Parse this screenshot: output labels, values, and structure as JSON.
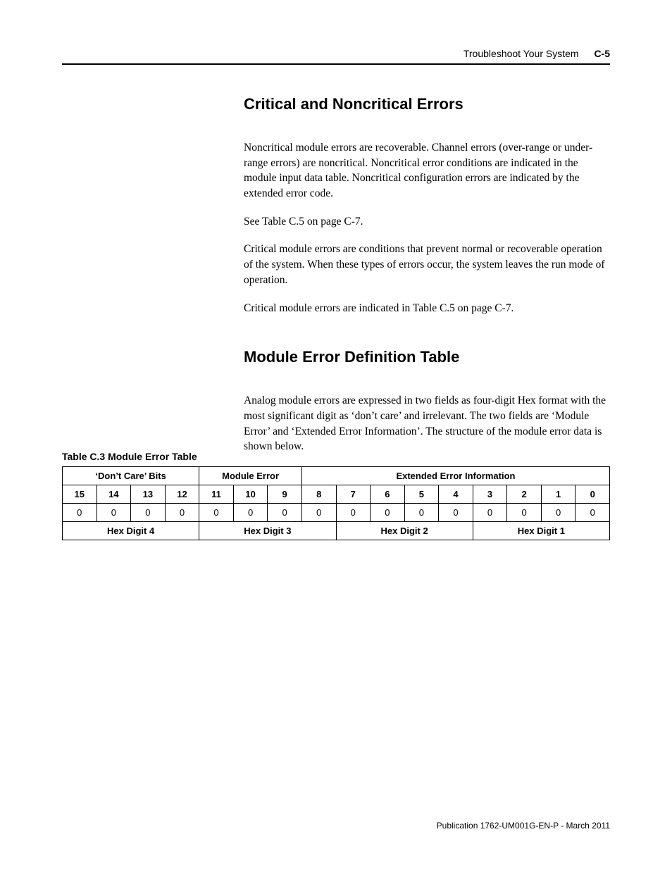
{
  "header": {
    "section": "Troubleshoot Your System",
    "pagenum": "C-5"
  },
  "section1": {
    "title": "Critical and Noncritical Errors",
    "p1": "Noncritical module errors are recoverable. Channel errors (over-range or under-range errors) are noncritical. Noncritical error conditions are indicated in the module input data table. Noncritical configuration errors are indicated by the extended error code.",
    "p2": "See Table C.5 on page C-7.",
    "p3": "Critical module errors are conditions that prevent normal or recoverable operation of the system. When these types of errors occur, the system leaves the run mode of operation.",
    "p4": "Critical module errors are indicated in Table C.5 on page C-7."
  },
  "section2": {
    "title": "Module Error Definition Table",
    "p1": "Analog module errors are expressed in two fields as four-digit Hex format with the most significant digit as ‘don’t care’ and irrelevant. The two fields are ‘Module Error’ and ‘Extended Error Information’. The structure of the module error data is shown below."
  },
  "table": {
    "caption": "Table C.3 Module Error Table",
    "groups": [
      "‘Don’t Care’ Bits",
      "Module Error",
      "Extended Error Information"
    ],
    "bits": [
      "15",
      "14",
      "13",
      "12",
      "11",
      "10",
      "9",
      "8",
      "7",
      "6",
      "5",
      "4",
      "3",
      "2",
      "1",
      "0"
    ],
    "values": [
      "0",
      "0",
      "0",
      "0",
      "0",
      "0",
      "0",
      "0",
      "0",
      "0",
      "0",
      "0",
      "0",
      "0",
      "0",
      "0"
    ],
    "hex": [
      "Hex Digit 4",
      "Hex Digit 3",
      "Hex Digit 2",
      "Hex Digit 1"
    ]
  },
  "footer": "Publication 1762-UM001G-EN-P - March 2011"
}
